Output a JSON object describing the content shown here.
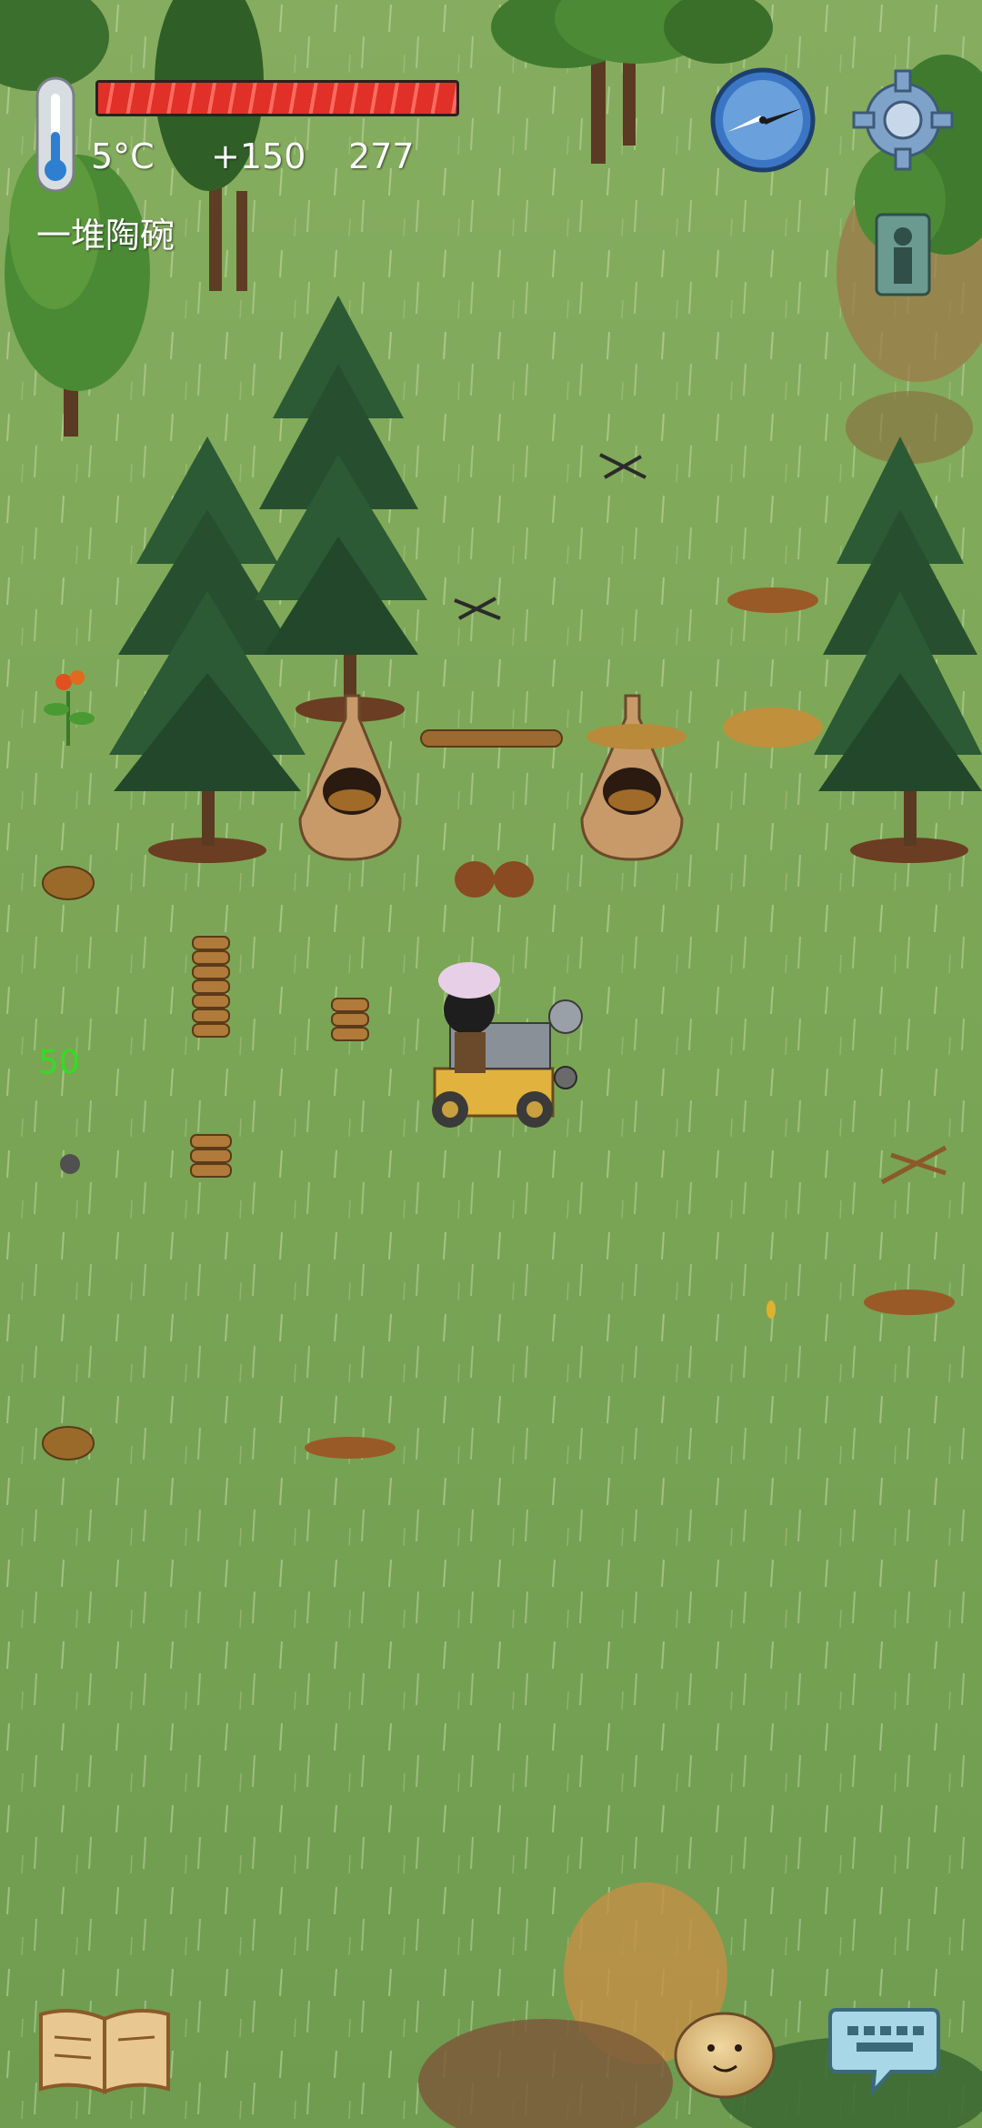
{
  "hud": {
    "temperature": "5°C",
    "bonus": "+150",
    "age": "277",
    "held_item": "一堆陶碗",
    "hunger_level": 1.0,
    "floating_number": "50"
  },
  "icons": {
    "thermometer": "thermometer-icon",
    "compass": "compass-icon",
    "settings": "gear-icon",
    "family": "family-icon",
    "tech_book": "book-icon",
    "emote": "emote-face-icon",
    "chat": "keyboard-chat-icon"
  },
  "colors": {
    "grass": "#7fa65a",
    "hunger_bar": "#e03028",
    "floating_number": "#33dd22",
    "text": "#ffffff"
  }
}
